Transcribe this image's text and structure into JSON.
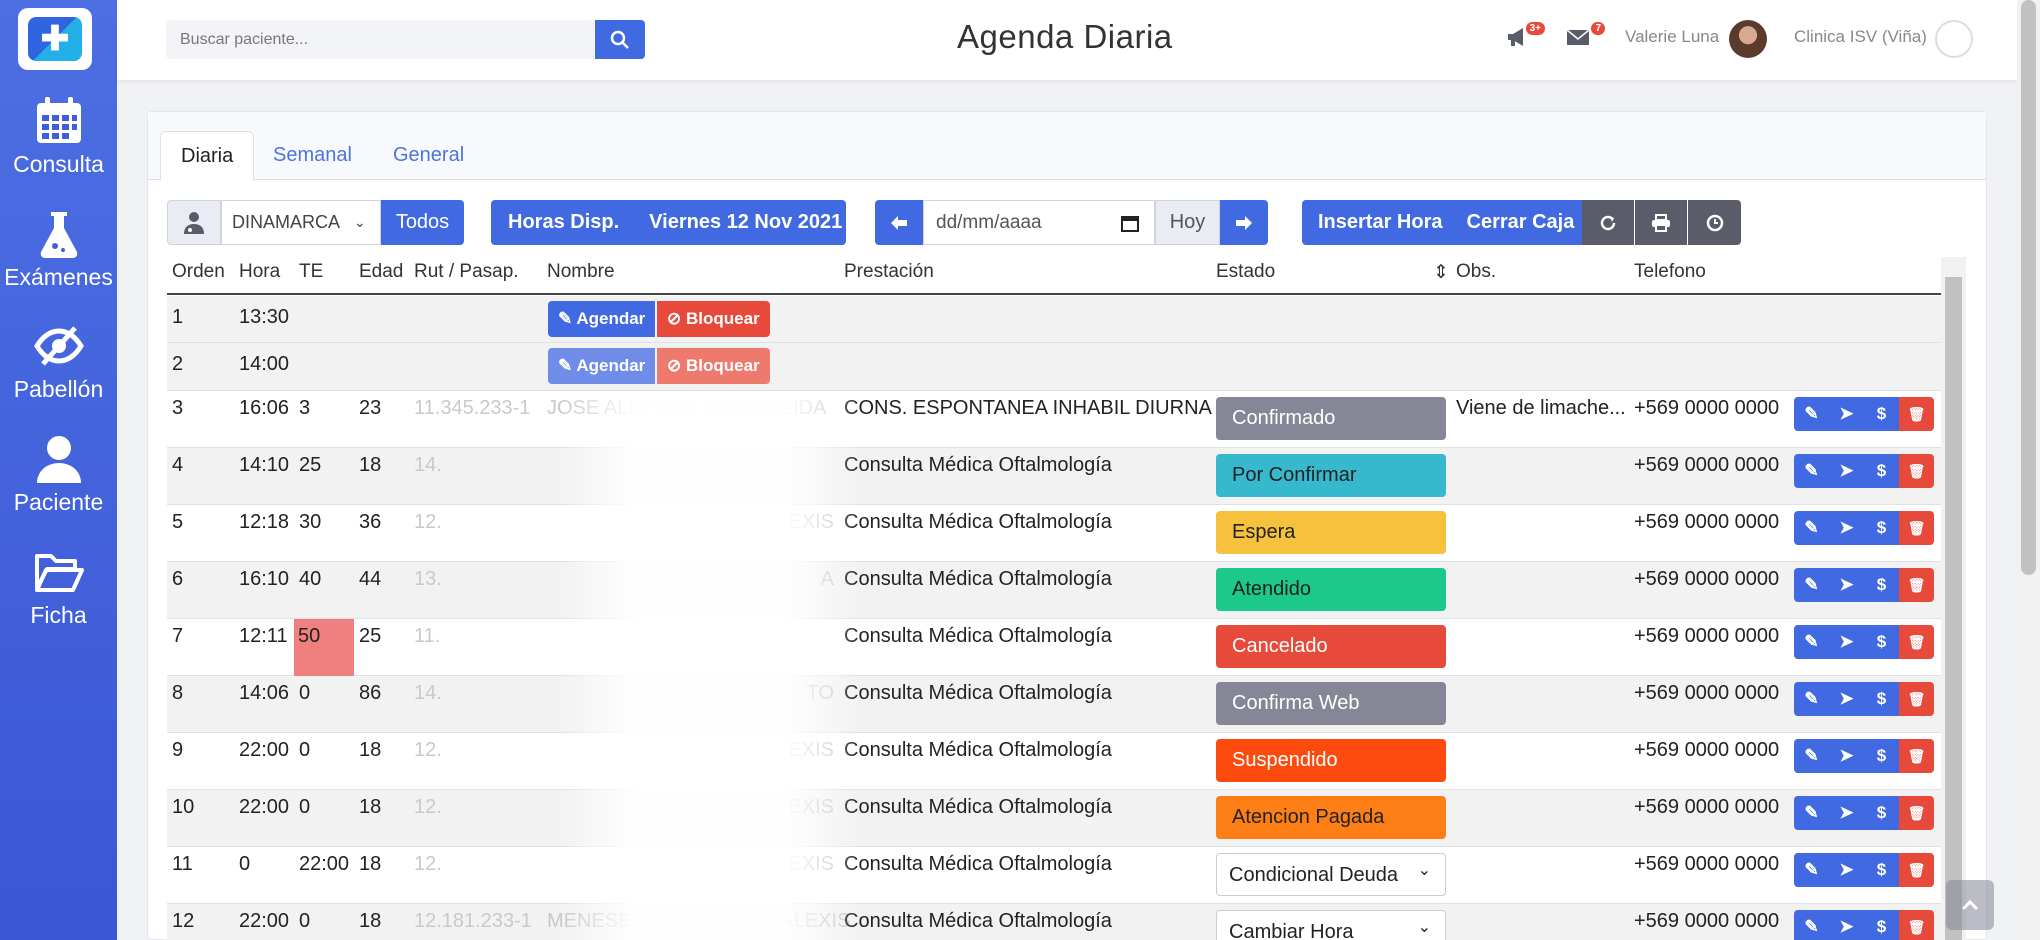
{
  "sidebar": {
    "items": [
      {
        "label": "Consulta",
        "icon": "calendar-icon"
      },
      {
        "label": "Exámenes",
        "icon": "flask-icon"
      },
      {
        "label": "Pabellón",
        "icon": "eye-slash-icon"
      },
      {
        "label": "Paciente",
        "icon": "user-icon"
      },
      {
        "label": "Ficha",
        "icon": "folder-open-icon"
      }
    ]
  },
  "header": {
    "search_placeholder": "Buscar paciente...",
    "title": "Agenda Diaria",
    "alerts_badge": "3+",
    "messages_badge": "7",
    "user_name": "Valerie Luna",
    "clinic_name": "Clinica ISV (Viña)"
  },
  "tabs": [
    "Diaria",
    "Semanal",
    "General"
  ],
  "toolbar": {
    "doctor_select": "DINAMARCA",
    "todos": "Todos",
    "horas_disp": "Horas Disp.",
    "fecha": "Viernes 12 Nov 2021",
    "date_placeholder": "dd/mm/aaaa",
    "hoy": "Hoy",
    "insertar_hora": "Insertar Hora",
    "cerrar_caja": "Cerrar Caja"
  },
  "table": {
    "headers": [
      "Orden",
      "Hora",
      "TE",
      "Edad",
      "Rut / Pasap.",
      "Nombre",
      "Prestación",
      "Estado",
      "Obs.",
      "Telefono"
    ],
    "agendar_label": "Agendar",
    "bloquear_label": "Bloquear",
    "free_rows": [
      {
        "orden": "1",
        "hora": "13:30"
      },
      {
        "orden": "2",
        "hora": "14:00"
      }
    ],
    "rows": [
      {
        "orden": "3",
        "hora": "16:06",
        "te": "3",
        "edad": "23",
        "rut": "11.345.233-1",
        "nombre": "JOSE ALBERTO FUENZALIDA",
        "prestacion": "CONS. ESPONTANEA INHABIL DIURNA",
        "estado": "Confirmado",
        "estado_color": "#858796",
        "obs": "Viene de limache...",
        "telefono": "+569 0000 0000"
      },
      {
        "orden": "4",
        "hora": "14:10",
        "te": "25",
        "edad": "18",
        "rut": "14.",
        "nombre": "",
        "prestacion": "Consulta Médica Oftalmología",
        "estado": "Por Confirmar",
        "estado_color": "#36b9cc",
        "obs": "",
        "telefono": "+569 0000 0000"
      },
      {
        "orden": "5",
        "hora": "12:18",
        "te": "30",
        "edad": "36",
        "rut": "12.",
        "nombre": "EXIS",
        "prestacion": "Consulta Médica Oftalmología",
        "estado": "Espera",
        "estado_color": "#f6c23e",
        "obs": "",
        "telefono": "+569 0000 0000"
      },
      {
        "orden": "6",
        "hora": "16:10",
        "te": "40",
        "edad": "44",
        "rut": "13.",
        "nombre": "A",
        "prestacion": "Consulta Médica Oftalmología",
        "estado": "Atendido",
        "estado_color": "#1cc88a",
        "obs": "",
        "telefono": "+569 0000 0000"
      },
      {
        "orden": "7",
        "hora": "12:11",
        "te": "50",
        "edad": "25",
        "rut": "11.",
        "nombre": "",
        "prestacion": "Consulta Médica Oftalmología",
        "estado": "Cancelado",
        "estado_color": "#e74a3b",
        "obs": "",
        "telefono": "+569 0000 0000"
      },
      {
        "orden": "8",
        "hora": "14:06",
        "te": "0",
        "edad": "86",
        "rut": "14.",
        "nombre": "TO",
        "prestacion": "Consulta Médica Oftalmología",
        "estado": "Confirma Web",
        "estado_color": "#858796",
        "obs": "",
        "telefono": "+569 0000 0000"
      },
      {
        "orden": "9",
        "hora": "22:00",
        "te": "0",
        "edad": "18",
        "rut": "12.",
        "nombre": "EXIS",
        "prestacion": "Consulta Médica Oftalmología",
        "estado": "Suspendido",
        "estado_color": "#fd4a0f",
        "obs": "",
        "telefono": "+569 0000 0000"
      },
      {
        "orden": "10",
        "hora": "22:00",
        "te": "0",
        "edad": "18",
        "rut": "12.",
        "nombre": "EXIS",
        "prestacion": "Consulta Médica Oftalmología",
        "estado": "Atencion Pagada",
        "estado_color": "#fd7e14",
        "obs": "",
        "telefono": "+569 0000 0000"
      },
      {
        "orden": "11",
        "hora": "0",
        "te": "22:00",
        "edad": "18",
        "rut": "12.",
        "nombre": "EXIS",
        "prestacion": "Consulta Médica Oftalmología",
        "estado": "Condicional Deuda",
        "estado_color": "select",
        "obs": "",
        "telefono": "+569 0000 0000"
      },
      {
        "orden": "12",
        "hora": "22:00",
        "te": "0",
        "edad": "18",
        "rut": "12.181.233-1",
        "nombre": "MENESES CONTRERAS ALEXIS",
        "prestacion": "Consulta Médica Oftalmología",
        "estado": "Cambiar Hora",
        "estado_color": "select",
        "obs": "",
        "telefono": "+569 0000 0000"
      }
    ]
  }
}
